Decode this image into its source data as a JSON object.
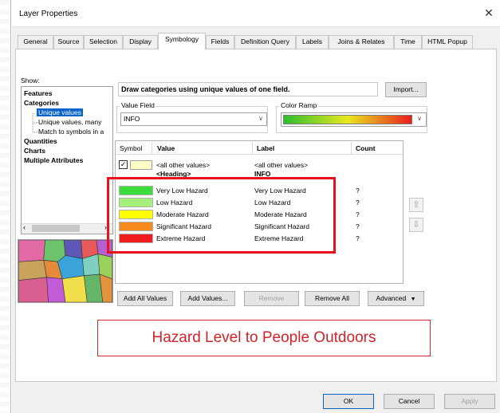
{
  "window": {
    "title": "Layer Properties",
    "close_glyph": "✕"
  },
  "tabs": [
    {
      "label": "General"
    },
    {
      "label": "Source"
    },
    {
      "label": "Selection"
    },
    {
      "label": "Display"
    },
    {
      "label": "Symbology",
      "active": true
    },
    {
      "label": "Fields"
    },
    {
      "label": "Definition Query"
    },
    {
      "label": "Labels"
    },
    {
      "label": "Joins & Relates"
    },
    {
      "label": "Time"
    },
    {
      "label": "HTML Popup"
    }
  ],
  "show": {
    "label": "Show:",
    "tree": [
      {
        "label": "Features",
        "bold": true
      },
      {
        "label": "Categories",
        "bold": true
      },
      {
        "label": "Unique values",
        "selected": true
      },
      {
        "label": "Unique values, many"
      },
      {
        "label": "Match to symbols in a"
      },
      {
        "label": "Quantities",
        "bold": true
      },
      {
        "label": "Charts",
        "bold": true
      },
      {
        "label": "Multiple Attributes",
        "bold": true
      }
    ]
  },
  "heading": "Draw categories using unique values of one field.",
  "import_button": "Import...",
  "value_field": {
    "label": "Value Field",
    "value": "INFO"
  },
  "color_ramp": {
    "label": "Color Ramp",
    "colors": [
      "#2dbf2d",
      "#e8e81e",
      "#e81e1e"
    ]
  },
  "table": {
    "columns": [
      "Symbol",
      "Value",
      "Label",
      "Count"
    ],
    "other_row": {
      "value": "<all other values>",
      "label": "<all other values>",
      "checked": true
    },
    "heading_row": {
      "value": "<Heading>",
      "label": "INFO"
    },
    "rows": [
      {
        "color": "#3cdc3c",
        "value": "Very Low Hazard",
        "label": "Very Low Hazard",
        "count": "?"
      },
      {
        "color": "#a8f07c",
        "value": "Low Hazard",
        "label": "Low Hazard",
        "count": "?"
      },
      {
        "color": "#ffff00",
        "value": "Moderate Hazard",
        "label": "Moderate Hazard",
        "count": "?"
      },
      {
        "color": "#f58a1e",
        "value": "Significant Hazard",
        "label": "Significant Hazard",
        "count": "?"
      },
      {
        "color": "#ee1c1c",
        "value": "Extreme Hazard",
        "label": "Extreme Hazard",
        "count": "?"
      }
    ]
  },
  "buttons": {
    "add_all": "Add All Values",
    "add_values": "Add Values...",
    "remove": "Remove",
    "remove_all": "Remove All",
    "advanced": "Advanced",
    "ok": "OK",
    "cancel": "Cancel",
    "apply": "Apply"
  },
  "caption": "Hazard Level to People Outdoors",
  "colors": {
    "highlight": "#e8121a",
    "caption_text": "#d2232a",
    "selection": "#0a64c8"
  }
}
